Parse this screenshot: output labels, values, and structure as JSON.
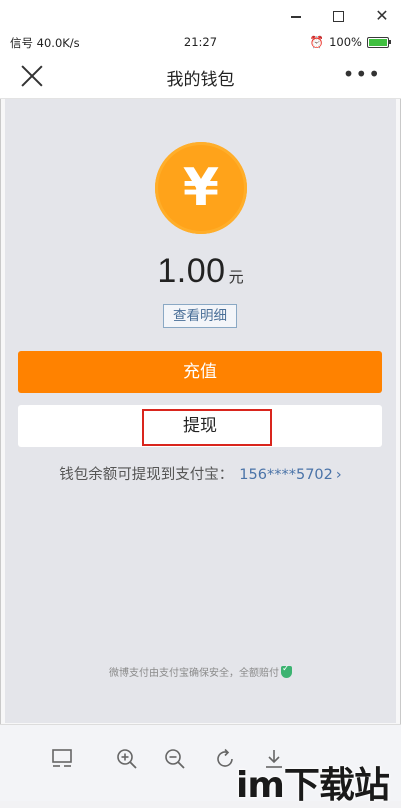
{
  "status_bar": {
    "left": "信号 40.0K/s",
    "time": "21:27",
    "battery": "100%"
  },
  "nav": {
    "title": "我的钱包",
    "close_icon": "close-icon",
    "more_icon": "more-icon"
  },
  "wallet": {
    "currency_symbol": "¥",
    "balance": "1.00",
    "unit": "元",
    "detail_label": "查看明细",
    "recharge_label": "充值",
    "withdraw_label": "提现",
    "alipay_text": "钱包余额可提现到支付宝：",
    "alipay_account": "156****5702",
    "security_text": "微博支付由支付宝确保安全，全额赔付"
  },
  "toolbar": {
    "icons": [
      "layout-icon",
      "zoom-in-icon",
      "zoom-out-icon",
      "rotate-icon",
      "download-icon"
    ]
  },
  "watermark": "im下载站",
  "colors": {
    "accent": "#ff8200",
    "coin": "#ffa31a",
    "link": "#4a73a8",
    "highlight": "#d9251d"
  }
}
